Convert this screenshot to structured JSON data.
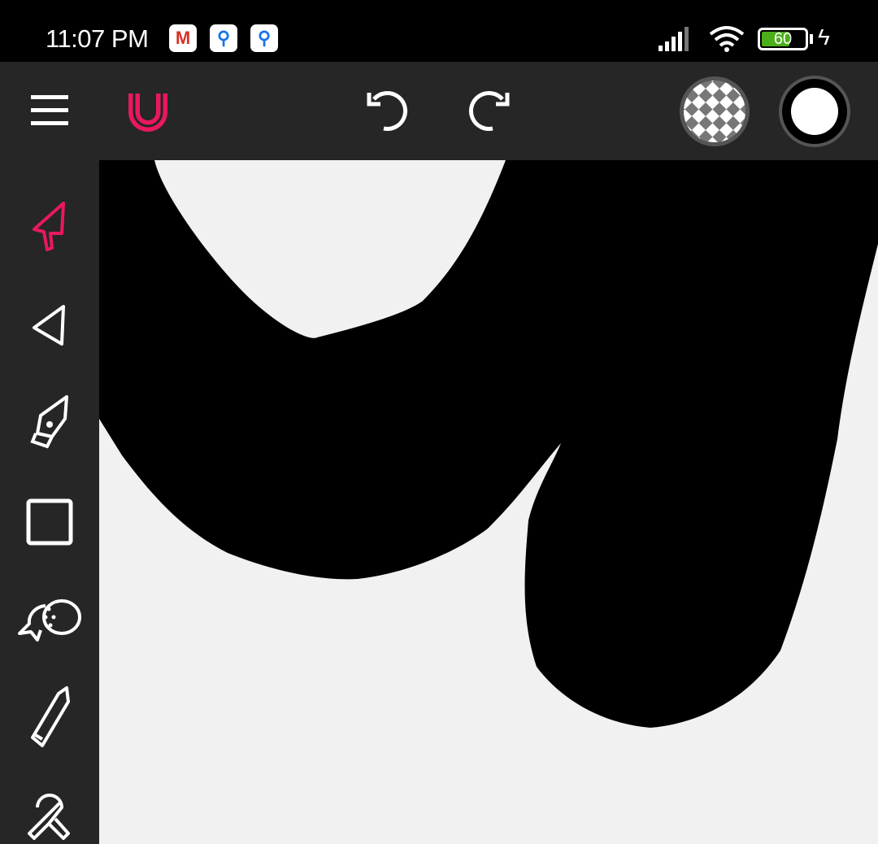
{
  "status_bar": {
    "time": "11:07 PM",
    "notifications": [
      "gmail-icon",
      "maps-icon",
      "maps-icon"
    ],
    "battery": "60"
  },
  "toolbar": {
    "menu": "menu-icon",
    "snap": "magnet-icon",
    "undo": "undo-icon",
    "redo": "redo-icon",
    "fill": "transparent-fill",
    "stroke": "white-stroke"
  },
  "colors": {
    "accent": "#e8185f",
    "panel": "#262626",
    "canvas": "#f1f1f1"
  },
  "tools": [
    "select",
    "direct-select",
    "pen",
    "rectangle",
    "lasso-shape-builder",
    "pencil",
    "ribbon"
  ]
}
